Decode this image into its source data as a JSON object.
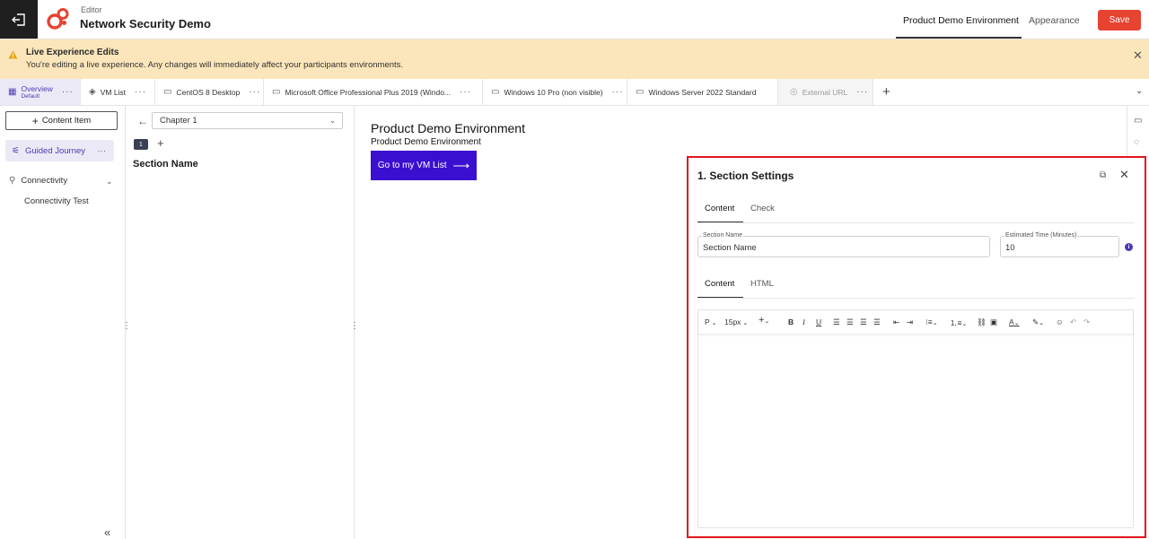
{
  "header": {
    "editor_label": "Editor",
    "app_title": "Network Security Demo",
    "tabs": [
      "Product Demo Environment",
      "Appearance"
    ],
    "save_label": "Save"
  },
  "banner": {
    "title": "Live Experience Edits",
    "text": "You're editing a live experience. Any changes will immediately affect your participants environments."
  },
  "tabs": [
    {
      "label": "Overview",
      "sub": "Default",
      "icon": "overview-icon"
    },
    {
      "label": "VM List",
      "icon": "stack-icon"
    },
    {
      "label": "CentOS 8 Desktop",
      "icon": "monitor-icon"
    },
    {
      "label": "Microsoft Office Professional Plus 2019 (Windo...",
      "icon": "monitor-icon"
    },
    {
      "label": "Windows 10 Pro (non visible)",
      "icon": "monitor-icon"
    },
    {
      "label": "Windows Server 2022 Standard",
      "icon": "monitor-icon"
    },
    {
      "label": "External URL",
      "icon": "eye-off-icon"
    }
  ],
  "sidebar": {
    "add_label": "Content Item",
    "items": [
      {
        "label": "Guided Journey",
        "active": true
      },
      {
        "label": "Connectivity"
      },
      {
        "label": "Connectivity Test"
      }
    ]
  },
  "middle": {
    "chapter": "Chapter 1",
    "section_number": "1",
    "section_name": "Section Name"
  },
  "preview": {
    "title": "Product Demo Environment",
    "subtitle": "Product Demo Environment",
    "button": "Go to my VM List"
  },
  "panel": {
    "title": "1. Section Settings",
    "tabs": [
      "Content",
      "Check"
    ],
    "section_name_label": "Section Name",
    "section_name_value": "Section Name",
    "time_label": "Estimated Time (Minutes)",
    "time_value": "10",
    "editor_tabs": [
      "Content",
      "HTML"
    ],
    "toolbar": {
      "paragraph": "P",
      "font_size": "15px"
    }
  },
  "colors": {
    "accent": "#4a3bb0",
    "save": "#e74331",
    "preview_button": "#3b0fd0",
    "banner": "#fbe5ba",
    "highlight_border": "#e0161e"
  }
}
